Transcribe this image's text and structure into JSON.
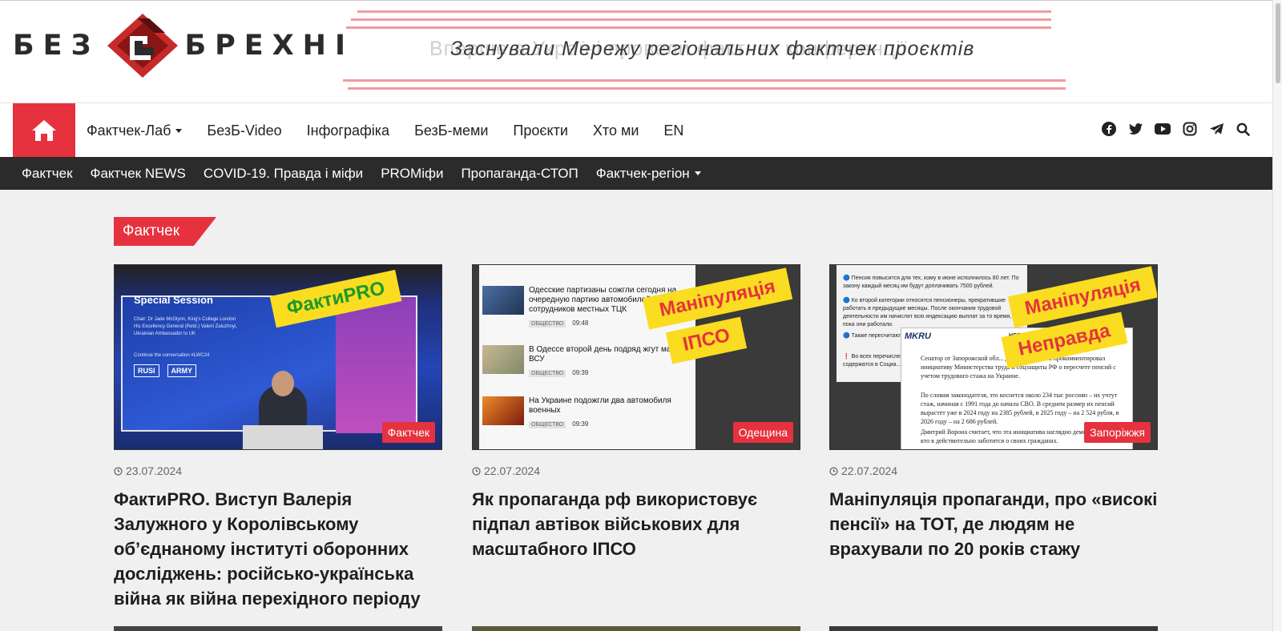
{
  "logo": {
    "left_word": "БЕЗ",
    "right_word": "БРЕХНІ"
  },
  "banner": {
    "ghost_text": "Вперше в Україні провели фактчек конференції",
    "text": "Заснували Мережу регіональних фактчек проєктів"
  },
  "nav": {
    "items": [
      {
        "label": "Фактчек-Лаб",
        "dropdown": true
      },
      {
        "label": "БезБ-Video",
        "dropdown": false
      },
      {
        "label": "Інфографіка",
        "dropdown": false
      },
      {
        "label": "БезБ-меми",
        "dropdown": false
      },
      {
        "label": "Проєкти",
        "dropdown": false
      },
      {
        "label": "Хто ми",
        "dropdown": false
      },
      {
        "label": "EN",
        "dropdown": false
      }
    ],
    "socials": [
      "facebook-icon",
      "twitter-icon",
      "youtube-icon",
      "instagram-icon",
      "telegram-icon",
      "search-icon"
    ]
  },
  "subnav": {
    "items": [
      {
        "label": "Фактчек",
        "dropdown": false
      },
      {
        "label": "Фактчек NEWS",
        "dropdown": false
      },
      {
        "label": "COVID-19. Правда і міфи",
        "dropdown": false
      },
      {
        "label": "PROMіфи",
        "dropdown": false
      },
      {
        "label": "Пропаганда-СТОП",
        "dropdown": false
      },
      {
        "label": "Фактчек-регіон",
        "dropdown": true
      }
    ]
  },
  "section": {
    "label": "Фактчек"
  },
  "cards": [
    {
      "category": "Фактчек",
      "date": "23.07.2024",
      "title": "ФактиPRO. Виступ Валерія Залужного у Королівському об’єднаному інституті оборонних досліджень: російсько-українська війна як війна перехідного періоду",
      "thumb": {
        "stamp": "ФактиPRO",
        "screen_title": "Special Session",
        "screen_lines": [
          "Chair: Dr Jade McGlynn, King's College London",
          "His Excellency General (Retd.) Valerii Zaluzhnyi,",
          "Ukrainian Ambassador to UK",
          "Continue the conversation #LWC24"
        ],
        "logos": [
          "RUSI",
          "ARMY"
        ]
      }
    },
    {
      "category": "Одещина",
      "date": "22.07.2024",
      "title": "Як пропаганда рф використовує підпал автівок військових для масштабного ІПСО",
      "thumb": {
        "stamps": [
          "Маніпуляція",
          "ІПСО"
        ],
        "rows": [
          {
            "text": "Одесские партизаны сожгли сегодня на очередную партию автомобилей сотрудников местных ТЦК",
            "tag": "ОБЩЕСТВО",
            "time": "09:48"
          },
          {
            "text": "В Одессе второй день подряд жгут маш... ВСУ",
            "tag": "ОБЩЕСТВО",
            "time": "09:39"
          },
          {
            "text": "На Украине подожгли два автомобиля военных",
            "tag": "ОБЩЕСТВО",
            "time": "09:39"
          }
        ]
      }
    },
    {
      "category": "Запоріжжя",
      "date": "22.07.2024",
      "title": "Маніпуляція пропаганди, про «високі пенсії» на ТОТ, де людям не врахували по 20 років стажу",
      "thumb": {
        "stamps": [
          "Маніпуляція",
          "Неправда"
        ],
        "panel_lines": [
          "🔵 Пенсия повысится для тех, кому в июне исполнилось 80 лет. По закону каждый месяц им будут доплачивать 7500 рублей.",
          "🔵 Ко второй категории относятся пенсионеры, прекратившие работать в предыдущие месяцы. После окончания трудовой деятельности им начислят всю индексацию выплат за то время, пока они работали.",
          "🔵 Также пересчитают... дополнительные докум...",
          "❗ Во всех перечисленн... для увеличения выплат... уже содержатся в Социа..."
        ],
        "doc_brand": "MKRU",
        "doc_header": "НОВОСТ",
        "doc_lines": [
          "Сенатор от Запорожской обл... Дмитрий Ворона прокомментировал инициативу Министерства труда и соцзащиты РФ о пересчете пенсий с учетом трудового стажа на Украине.",
          "По словам законодателя, это коснется около 234 тыс россиян – их учтут стаж, начиная с 1991 года до начала СВО. В среднем размер их пенсий вырастет уже в 2024 году на 2385 рублей, в 2025 году – на 2 524 рубля, в 2026 году – на 2 686 рублей.",
          "Дмитрий Ворона считает, что эта инициатива наглядно демонстрирует, кто в действительно заботится о своих гражданах."
        ]
      }
    }
  ],
  "colors": {
    "accent": "#e5323e",
    "subnav_bg": "#2b2b2b",
    "stamp_yellow": "#fadc21"
  }
}
